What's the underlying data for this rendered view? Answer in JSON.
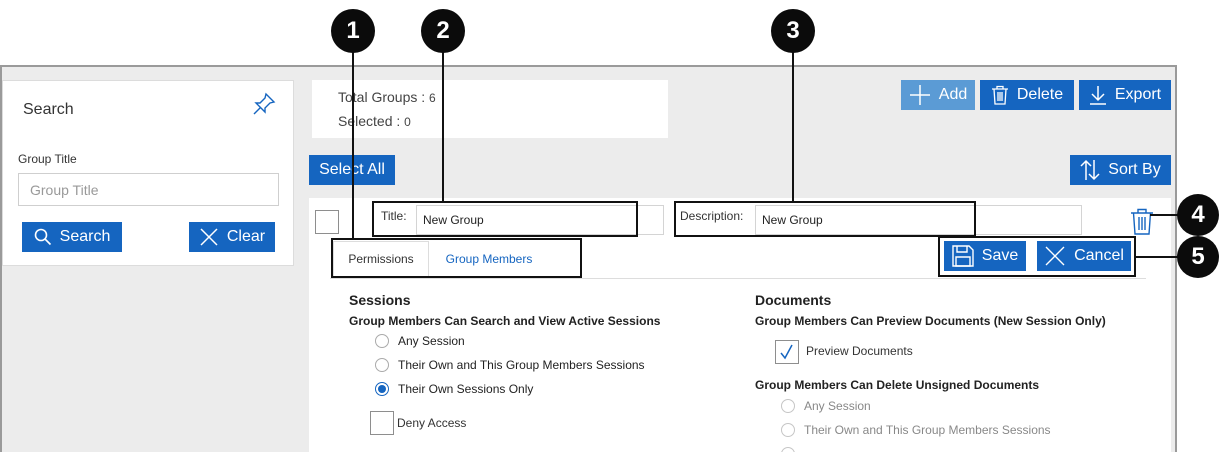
{
  "search": {
    "title": "Search",
    "field_label": "Group Title",
    "placeholder": "Group Title",
    "search_button": "Search",
    "clear_button": "Clear"
  },
  "totals": {
    "groups_label": "Total Groups :",
    "groups_value": "6",
    "selected_label": "Selected :",
    "selected_value": "0"
  },
  "toolbar": {
    "add": "Add",
    "delete": "Delete",
    "export": "Export",
    "select_all": "Select All",
    "sort_by": "Sort By"
  },
  "group": {
    "title_label": "Title:",
    "title_value": "New Group",
    "description_label": "Description:",
    "description_value": "New Group",
    "save": "Save",
    "cancel": "Cancel"
  },
  "tabs": [
    "Permissions",
    "Group Members"
  ],
  "sessions": {
    "title": "Sessions",
    "subtitle": "Group Members Can Search and View Active Sessions",
    "options": [
      "Any Session",
      "Their Own and This Group Members Sessions",
      "Their Own Sessions Only"
    ],
    "selected_index": 2,
    "deny_access": "Deny Access"
  },
  "documents": {
    "title": "Documents",
    "preview_subtitle": "Group Members Can Preview Documents (New Session Only)",
    "preview_label": "Preview Documents",
    "preview_checked": true,
    "delete_subtitle": "Group Members Can Delete Unsigned Documents",
    "delete_options": [
      "Any Session",
      "Their Own and This Group Members Sessions"
    ]
  },
  "callouts": [
    "1",
    "2",
    "3",
    "4",
    "5"
  ],
  "colors": {
    "accent": "#1565c0",
    "accent_disabled": "#5b9bd5",
    "background": "#ececec"
  }
}
